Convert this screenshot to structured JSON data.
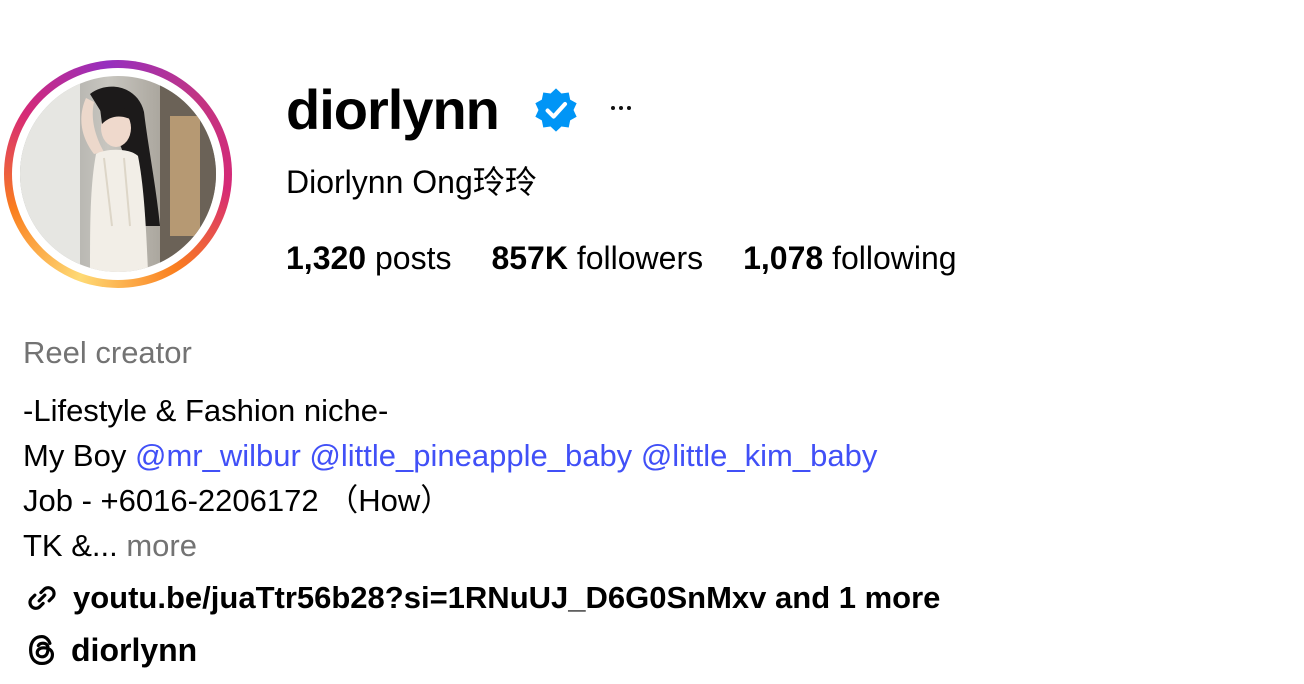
{
  "profile": {
    "username": "diorlynn",
    "verified": true,
    "full_name": "Diorlynn Ong玲玲",
    "stats": {
      "posts_count": "1,320",
      "posts_label": "posts",
      "followers_count": "857K",
      "followers_label": "followers",
      "following_count": "1,078",
      "following_label": "following"
    },
    "category": "Reel creator",
    "bio": {
      "line1": "-Lifestyle & Fashion niche-",
      "line2_prefix": "My Boy ",
      "mentions": [
        "@mr_wilbur",
        "@little_pineapple_baby",
        "@little_kim_baby"
      ],
      "line3": "Job - +6016-2206172 （How）",
      "line4_prefix": "TK &... ",
      "more": "more"
    },
    "link_text": "youtu.be/juaTtr56b28?si=1RNuUJ_D6G0SnMxv and 1 more",
    "threads_handle": "diorlynn"
  },
  "icons": {
    "verified": "verified-badge-icon",
    "more": "more-options-icon",
    "link": "link-icon",
    "threads": "threads-icon"
  },
  "colors": {
    "mention": "#4150f7",
    "secondary_text": "#737373",
    "verified": "#0095f6"
  }
}
